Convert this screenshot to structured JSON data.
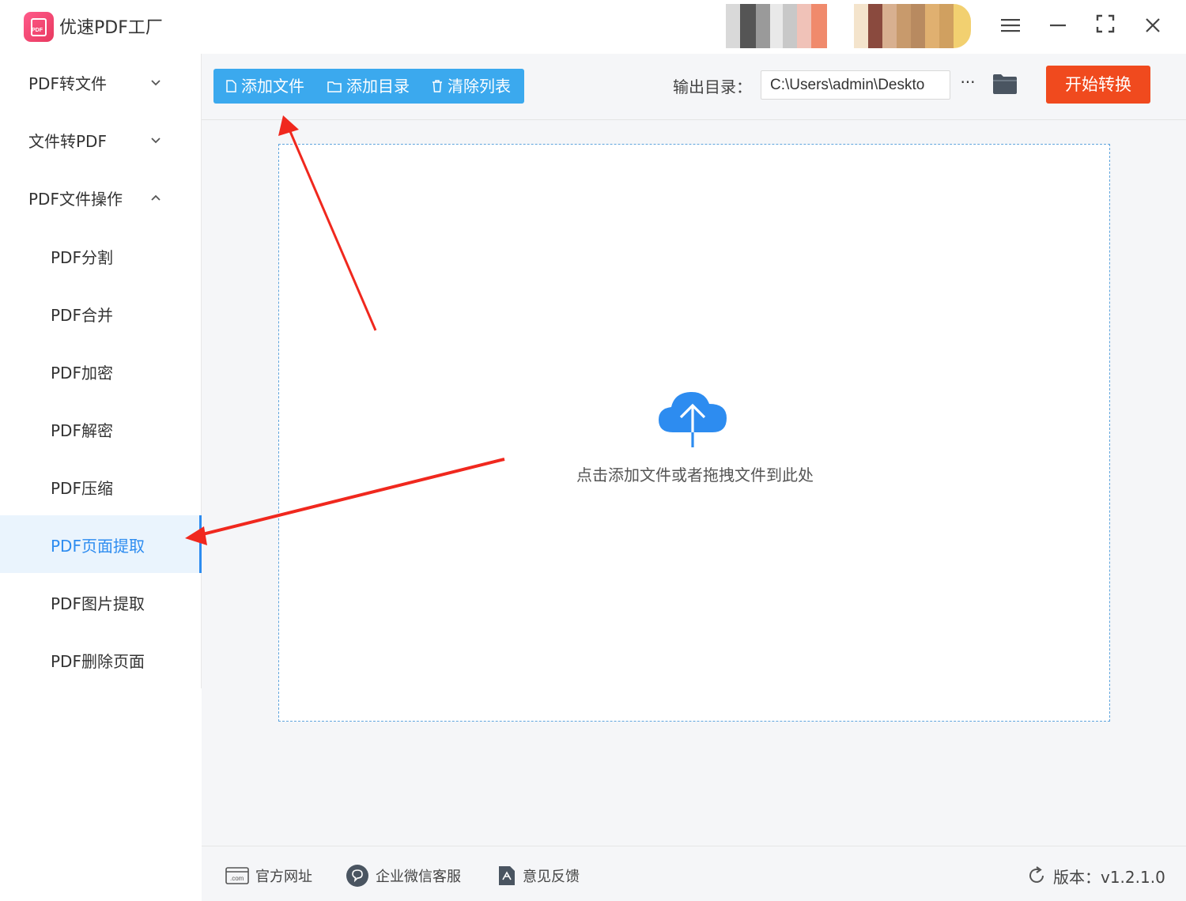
{
  "app": {
    "title": "优速PDF工厂",
    "logo_text": "PDF"
  },
  "window_controls": {
    "menu_icon": "hamburger-icon",
    "minimize_icon": "minimize-icon",
    "maximize_icon": "fullscreen-icon",
    "close_icon": "close-icon"
  },
  "sidebar": {
    "groups": [
      {
        "label": "PDF转文件",
        "expanded": false
      },
      {
        "label": "文件转PDF",
        "expanded": false
      },
      {
        "label": "PDF文件操作",
        "expanded": true
      }
    ],
    "items": [
      {
        "label": "PDF分割",
        "active": false
      },
      {
        "label": "PDF合并",
        "active": false
      },
      {
        "label": "PDF加密",
        "active": false
      },
      {
        "label": "PDF解密",
        "active": false
      },
      {
        "label": "PDF压缩",
        "active": false
      },
      {
        "label": "PDF页面提取",
        "active": true
      },
      {
        "label": "PDF图片提取",
        "active": false
      },
      {
        "label": "PDF删除页面",
        "active": false
      }
    ]
  },
  "toolbar": {
    "add_file": "添加文件",
    "add_folder": "添加目录",
    "clear_list": "清除列表",
    "output_label": "输出目录：",
    "output_path": "C:\\Users\\admin\\Deskto",
    "more": "···",
    "start": "开始转换"
  },
  "dropzone": {
    "hint": "点击添加文件或者拖拽文件到此处",
    "icon": "cloud-upload-icon"
  },
  "footer": {
    "website": "官方网址",
    "wechat": "企业微信客服",
    "feedback": "意见反馈",
    "version": "版本：v1.2.1.0"
  },
  "colors": {
    "accent": "#2d8cf0",
    "toolbar_button": "#3ba9ee",
    "start_button": "#f04a1e",
    "annotation_arrow": "#f0281e"
  }
}
